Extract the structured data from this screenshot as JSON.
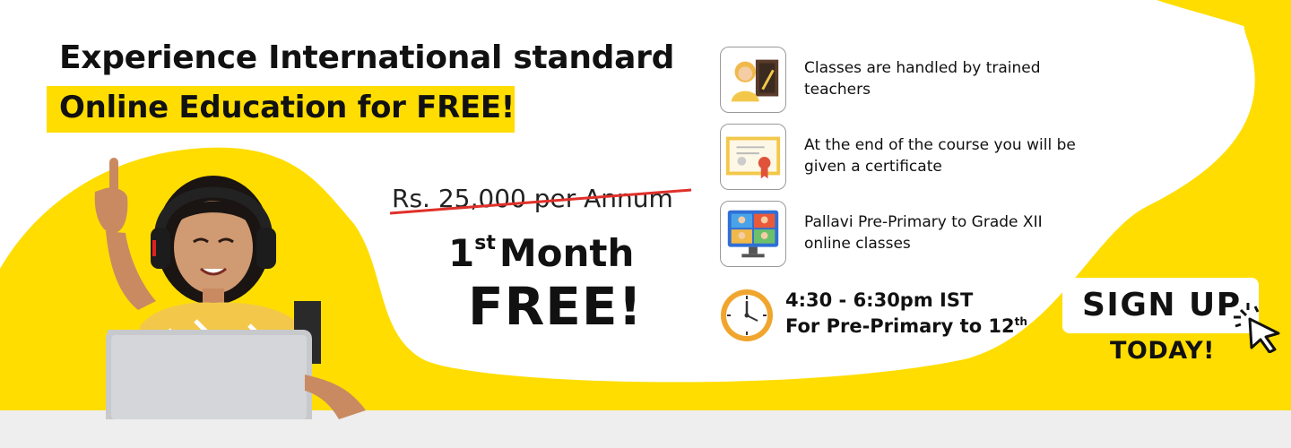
{
  "headline": {
    "line1": "Experience International standard",
    "line2": "Online Education for FREE!"
  },
  "price": {
    "old": "Rs. 25,000 per Annum",
    "offer_number": "1",
    "offer_suffix": "st",
    "offer_rest": "Month",
    "offer_free": "FREE!"
  },
  "features": [
    {
      "icon": "teacher-icon",
      "text": "Classes are handled by trained teachers"
    },
    {
      "icon": "certificate-icon",
      "text": "At the end of the course you will be given a certificate"
    },
    {
      "icon": "video-classes-icon",
      "text": "Pallavi Pre-Primary to Grade XII online classes"
    }
  ],
  "schedule": {
    "icon": "clock-icon",
    "time": "4:30 - 6:30pm IST",
    "grades_prefix": "For Pre-Primary to 12",
    "grades_suffix": "th"
  },
  "cta": {
    "button_label": "SIGN UP",
    "sub_label": "TODAY!"
  },
  "colors": {
    "accent_yellow": "#ffdd00",
    "strike_red": "#e0302a",
    "text_dark": "#111111"
  }
}
